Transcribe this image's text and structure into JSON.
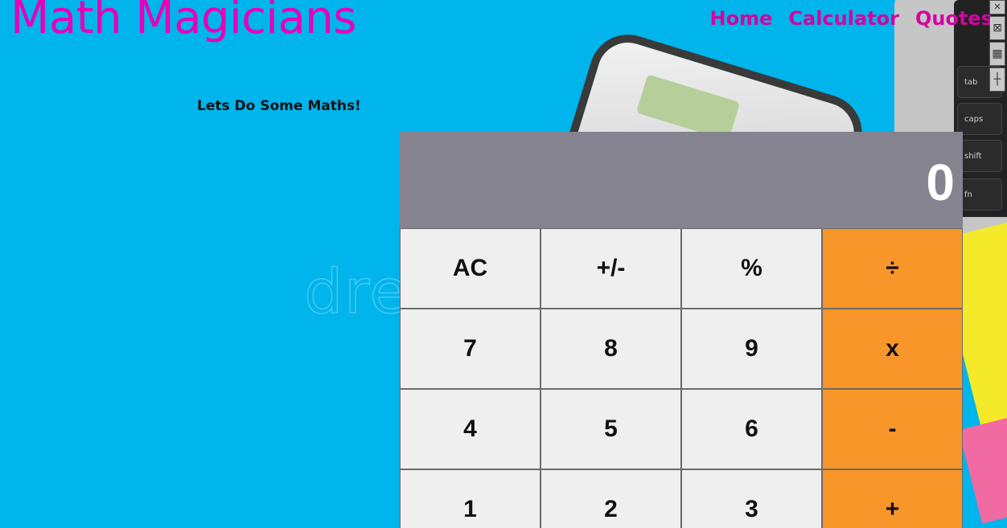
{
  "header": {
    "logo": "Math Magicians",
    "nav": [
      "Home",
      "Calculator",
      "Quotes"
    ]
  },
  "heading": "Lets Do Some Maths!",
  "calculator": {
    "display": "0",
    "rows": [
      [
        "AC",
        "+/-",
        "%",
        "÷"
      ],
      [
        "7",
        "8",
        "9",
        "x"
      ],
      [
        "4",
        "5",
        "6",
        "-"
      ],
      [
        "1",
        "2",
        "3",
        "+"
      ]
    ]
  },
  "background": {
    "watermark": "dre",
    "keys": [
      "tab",
      "caps lock",
      "shift",
      "fn"
    ]
  },
  "colors": {
    "background": "#00b4ec",
    "brand": "#e600b8",
    "display": "#85838f",
    "operator": "#f8962a",
    "key": "#efefef"
  }
}
